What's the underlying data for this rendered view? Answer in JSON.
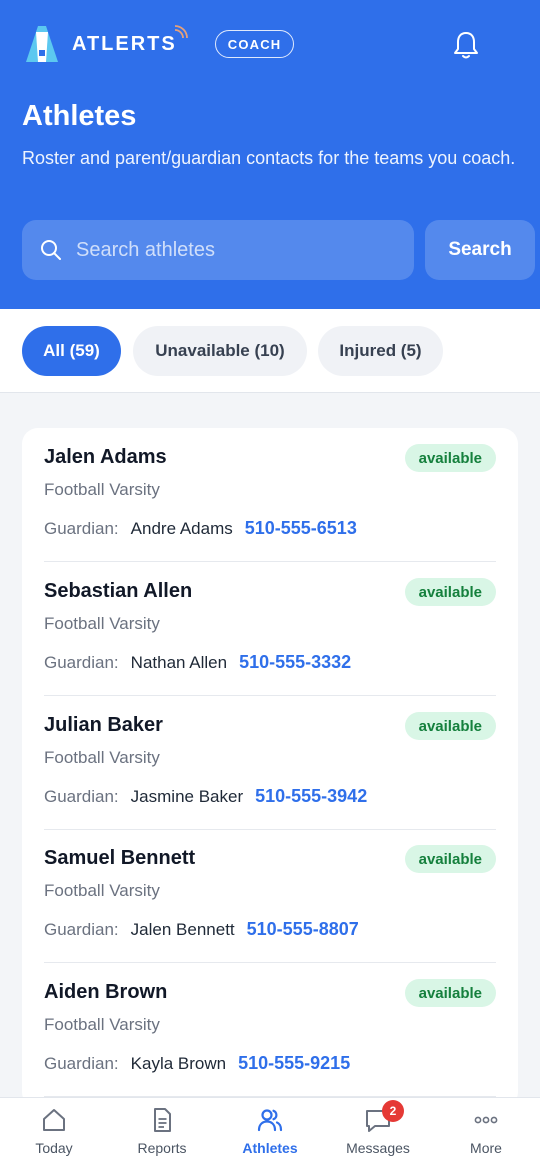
{
  "app": {
    "logo_text": "ATLERTS",
    "role_badge": "COACH"
  },
  "header": {
    "title": "Athletes",
    "subtitle": "Roster and parent/guardian contacts for the teams you coach."
  },
  "search": {
    "placeholder": "Search athletes",
    "value": "",
    "button_label": "Search"
  },
  "filters": [
    {
      "label": "All (59)",
      "active": true
    },
    {
      "label": "Unavailable (10)",
      "active": false
    },
    {
      "label": "Injured (5)",
      "active": false
    }
  ],
  "athletes": [
    {
      "name": "Jalen Adams",
      "team": "Football Varsity",
      "guardian_label": "Guardian:",
      "guardian_name": "Andre Adams",
      "phone": "510-555-6513",
      "status": "available"
    },
    {
      "name": "Sebastian Allen",
      "team": "Football Varsity",
      "guardian_label": "Guardian:",
      "guardian_name": "Nathan Allen",
      "phone": "510-555-3332",
      "status": "available"
    },
    {
      "name": "Julian Baker",
      "team": "Football Varsity",
      "guardian_label": "Guardian:",
      "guardian_name": "Jasmine Baker",
      "phone": "510-555-3942",
      "status": "available"
    },
    {
      "name": "Samuel Bennett",
      "team": "Football Varsity",
      "guardian_label": "Guardian:",
      "guardian_name": "Jalen Bennett",
      "phone": "510-555-8807",
      "status": "available"
    },
    {
      "name": "Aiden Brown",
      "team": "Football Varsity",
      "guardian_label": "Guardian:",
      "guardian_name": "Kayla Brown",
      "phone": "510-555-9215",
      "status": "available"
    }
  ],
  "nav": {
    "today": "Today",
    "reports": "Reports",
    "athletes": "Athletes",
    "messages": "Messages",
    "messages_badge": "2",
    "more": "More"
  },
  "colors": {
    "primary": "#2f6fea",
    "available_bg": "#d9f6e6",
    "available_text": "#15803d",
    "badge_red": "#e53935"
  }
}
